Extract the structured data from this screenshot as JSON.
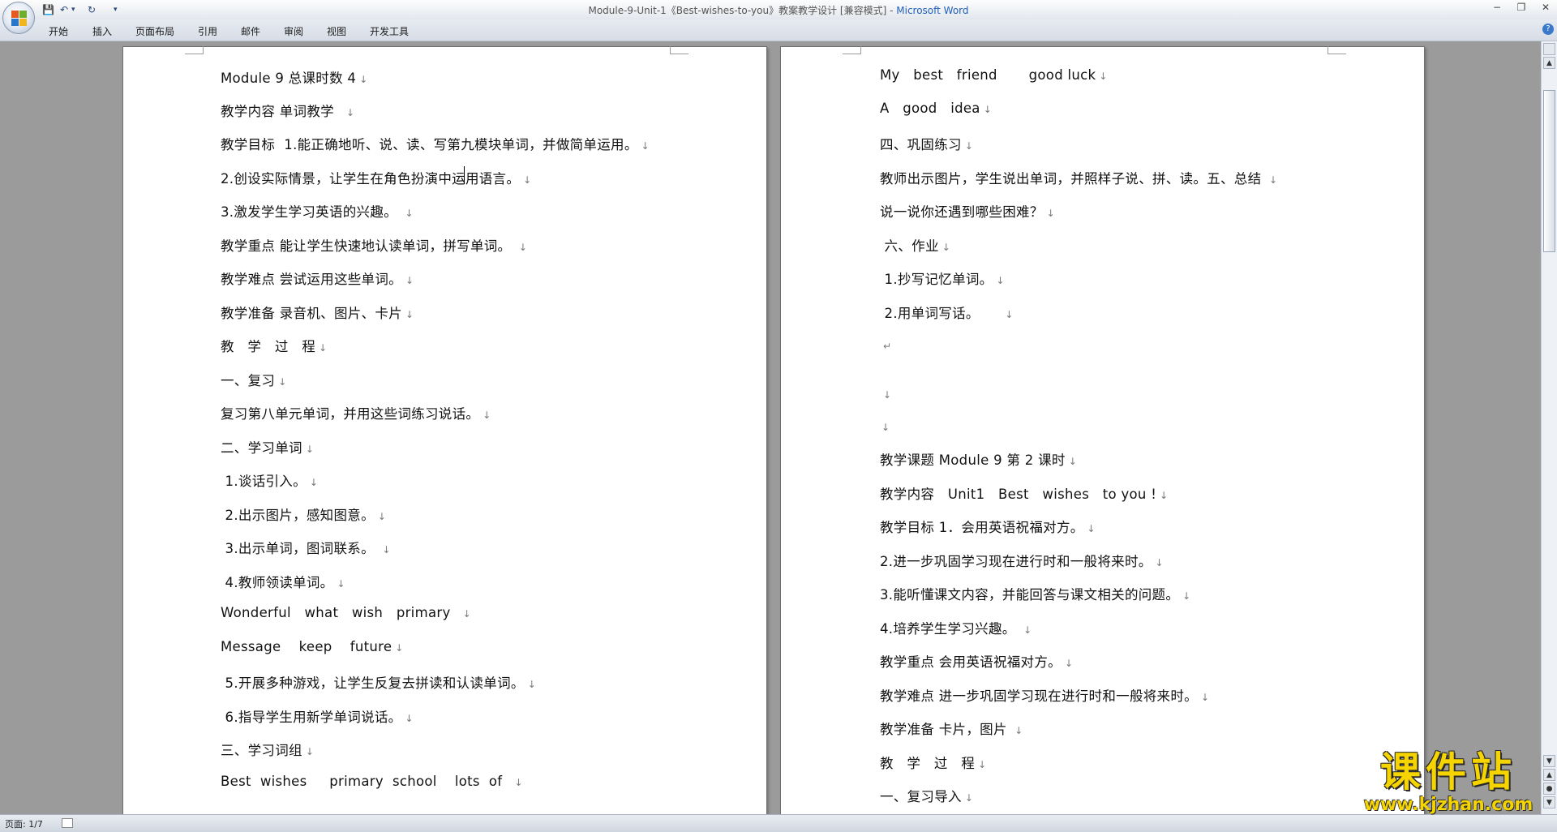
{
  "window": {
    "title_doc": "Module-9-Unit-1《Best-wishes-to-you》教案教学设计 [兼容模式] - ",
    "title_app": "Microsoft Word",
    "qat": {
      "save": "💾",
      "undo": "↶",
      "undo_drop": "▾",
      "redo": "↻",
      "customize": "▾"
    },
    "controls": {
      "minimize": "−",
      "restore": "❐",
      "close": "✕"
    }
  },
  "ribbon": {
    "tabs": [
      "开始",
      "插入",
      "页面布局",
      "引用",
      "邮件",
      "审阅",
      "视图",
      "开发工具"
    ],
    "help": "?"
  },
  "page1": {
    "lines": [
      "Module 9 总课时数 4",
      "教学内容 单词教学  ",
      "教学目标  1.能正确地听、说、读、写第九模块单词，并做简单运用。",
      "2.创设实际情景，让学生在角色扮演中运用语言。",
      "3.激发学生学习英语的兴趣。 ",
      "教学重点 能让学生快速地认读单词，拼写单词。 ",
      "教学难点 尝试运用这些单词。",
      "教学准备 录音机、图片、卡片",
      "教   学   过   程",
      "一、复习",
      "复习第八单元单词，并用这些词练习说话。",
      "二、学习单词",
      " 1.谈话引入。",
      " 2.出示图片，感知图意。",
      " 3.出示单词，图词联系。 ",
      " 4.教师领读单词。",
      "Wonderful   what   wish   primary  ",
      "Message    keep    future",
      " 5.开展多种游戏，让学生反复去拼读和认读单词。",
      " 6.指导学生用新学单词说话。",
      "三、学习词组",
      "Best  wishes     primary  school    lots  of  "
    ]
  },
  "page2": {
    "lines": [
      "My   best   friend       good luck",
      "A   good   idea",
      "四、巩固练习",
      "教师出示图片，学生说出单词，并照样子说、拼、读。五、总结 ",
      "说一说你还遇到哪些困难？",
      " 六、作业",
      " 1.抄写记忆单词。",
      " 2.用单词写话。     ",
      "",
      "",
      "",
      "教学课题 Module 9 第 2 课时",
      "教学内容   Unit1   Best   wishes   to you !",
      "教学目标 1．会用英语祝福对方。",
      "2.进一步巩固学习现在进行时和一般将来时。",
      "3.能听懂课文内容，并能回答与课文相关的问题。",
      "4.培养学生学习兴趣。 ",
      "教学重点 会用英语祝福对方。",
      "教学难点 进一步巩固学习现在进行时和一般将来时。",
      "教学准备 卡片，图片 ",
      "教   学   过   程",
      "一、复习导入"
    ]
  },
  "paragraph_mark": "↓",
  "paragraph_mark_hard": "↵",
  "statusbar": {
    "page": "页面: 1/7"
  },
  "watermark": {
    "title": "课件站",
    "url": "www.kjzhan.com"
  },
  "colors": {
    "app_title": "#2060b8",
    "watermark": "#f5d400",
    "workspace": "#9b9b9b"
  }
}
